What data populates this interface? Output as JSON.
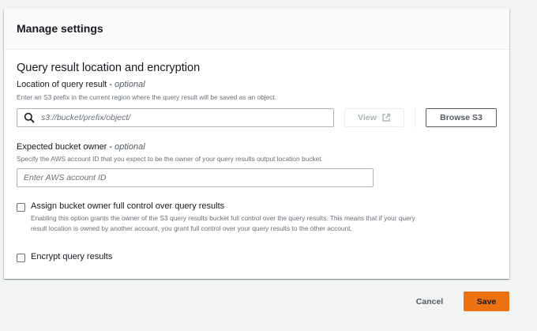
{
  "panel": {
    "title": "Manage settings"
  },
  "section": {
    "title": "Query result location and encryption"
  },
  "location": {
    "label": "Location of query result - ",
    "label_optional": "optional",
    "description": "Enter an S3 prefix in the current region where the query result will be saved as an object.",
    "placeholder": "s3://bucket/prefix/object/",
    "view_label": "View",
    "browse_label": "Browse S3"
  },
  "owner": {
    "label": "Expected bucket owner - ",
    "label_optional": "optional",
    "description": "Specify the AWS account ID that you expect to be the owner of your query results output location bucket.",
    "placeholder": "Enter AWS account ID"
  },
  "full_control": {
    "label": "Assign bucket owner full control over query results",
    "description_line1": "Enabling this option grants the owner of the S3 query results bucket full control over the query results. This means that if your query",
    "description_line2": "result location is owned by another account, you grant full control over your query results to the other account.",
    "checked": false
  },
  "encrypt": {
    "label": "Encrypt query results",
    "checked": false
  },
  "footer": {
    "cancel_label": "Cancel",
    "save_label": "Save"
  },
  "colors": {
    "primary": "#ec7211",
    "border": "#aab7b8",
    "text": "#16191f"
  },
  "icons": {
    "search": "search-icon",
    "external": "external-link-icon"
  }
}
